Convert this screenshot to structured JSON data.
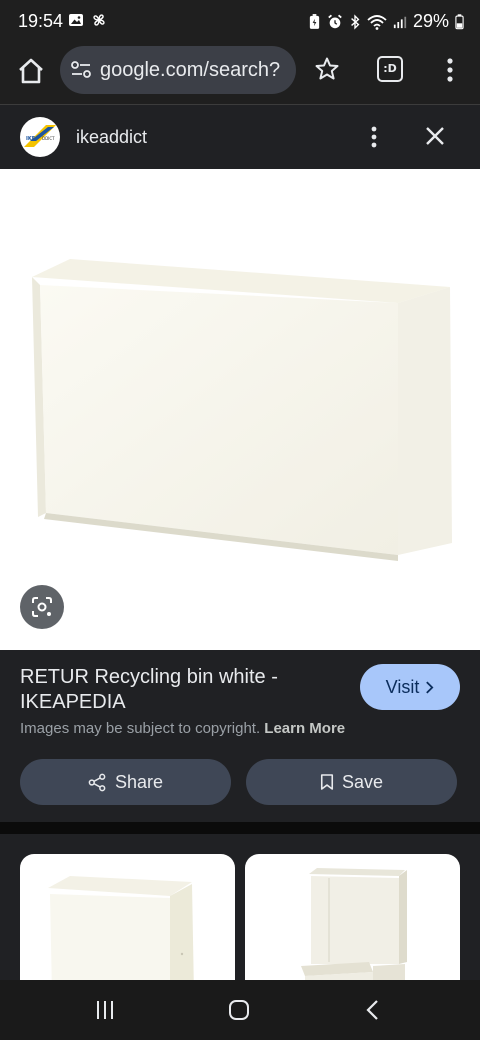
{
  "status_bar": {
    "time": "19:54",
    "battery": "29%",
    "icons_left": [
      "image-icon",
      "pinwheel-icon"
    ],
    "icons_right": [
      "battery-saver-icon",
      "alarm-icon",
      "bluetooth-icon",
      "wifi-icon",
      "signal-icon",
      "battery-icon"
    ]
  },
  "toolbar": {
    "url": "google.com/search?",
    "tab_label": ":D"
  },
  "source": {
    "name": "ikeaddict",
    "logo_text": "IKEADDICT"
  },
  "result": {
    "title": "RETUR Recycling bin white - IKEAPEDIA",
    "visit_label": "Visit",
    "copyright_text": "Images may be subject to copyright.",
    "learn_more_label": "Learn More",
    "share_label": "Share",
    "save_label": "Save"
  },
  "colors": {
    "accent": "#a8c7fa",
    "surface": "#202124",
    "button_bg": "#3f4756"
  }
}
